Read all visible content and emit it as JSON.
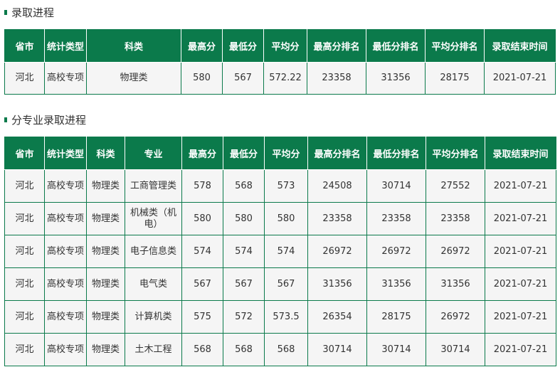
{
  "section1": {
    "title": "录取进程",
    "headers": [
      "省市",
      "统计类型",
      "科类",
      "最高分",
      "最低分",
      "平均分",
      "最高分排名",
      "最低分排名",
      "平均分排名",
      "录取结束时间"
    ],
    "rows": [
      [
        "河北",
        "高校专项",
        "物理类",
        "580",
        "567",
        "572.22",
        "23358",
        "31356",
        "28175",
        "2021-07-21"
      ]
    ]
  },
  "section2": {
    "title": "分专业录取进程",
    "headers": [
      "省市",
      "统计类型",
      "科类",
      "专业",
      "最高分",
      "最低分",
      "平均分",
      "最高分排名",
      "最低分排名",
      "平均分排名",
      "录取结束时间"
    ],
    "rows": [
      [
        "河北",
        "高校专项",
        "物理类",
        "工商管理类",
        "578",
        "568",
        "573",
        "24508",
        "30714",
        "27552",
        "2021-07-21"
      ],
      [
        "河北",
        "高校专项",
        "物理类",
        "机械类（机电）",
        "580",
        "580",
        "580",
        "23358",
        "23358",
        "23358",
        "2021-07-21"
      ],
      [
        "河北",
        "高校专项",
        "物理类",
        "电子信息类",
        "574",
        "574",
        "574",
        "26972",
        "26972",
        "26972",
        "2021-07-21"
      ],
      [
        "河北",
        "高校专项",
        "物理类",
        "电气类",
        "567",
        "567",
        "567",
        "31356",
        "31356",
        "31356",
        "2021-07-21"
      ],
      [
        "河北",
        "高校专项",
        "物理类",
        "计算机类",
        "575",
        "572",
        "573.5",
        "26354",
        "28175",
        "26972",
        "2021-07-21"
      ],
      [
        "河北",
        "高校专项",
        "物理类",
        "土木工程",
        "568",
        "568",
        "568",
        "30714",
        "30714",
        "30714",
        "2021-07-21"
      ]
    ]
  }
}
